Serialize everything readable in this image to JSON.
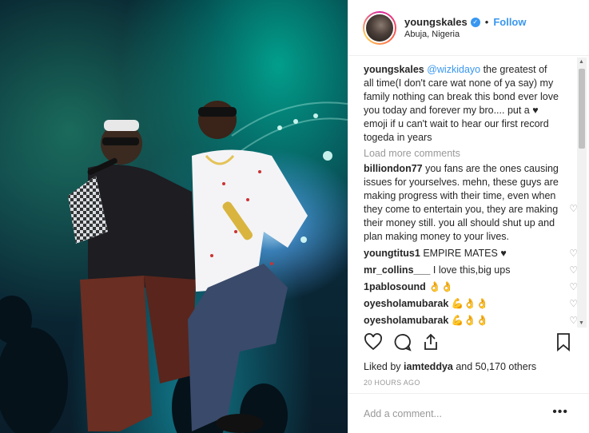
{
  "post": {
    "username": "youngskales",
    "separator": "•",
    "follow_label": "Follow",
    "location": "Abuja, Nigeria",
    "verified_icon": "verified-badge-icon"
  },
  "caption": {
    "username": "youngskales",
    "mention": "@wizkidayo",
    "text": " the greatest of all time(I don't care wat none of ya say) my family nothing can break this bond ever love you today and forever my bro.... put a ♥ emoji if u can't wait to hear our first record togeda in years"
  },
  "load_more": "Load more comments",
  "comments": [
    {
      "user": "billiondon77",
      "text": "you fans are the ones causing issues for yourselves. mehn, these guys are making progress with their time, even when they come to entertain you, they are making their money still. you all should shut up and plan making money to your lives."
    },
    {
      "user": "youngtitus1",
      "text": "EMPIRE MATES ♥"
    },
    {
      "user": "mr_collins___",
      "text": "I love this,big ups"
    },
    {
      "user": "1pablosound",
      "text": "👌👌"
    },
    {
      "user": "oyesholamubarak",
      "text": "💪👌👌"
    },
    {
      "user": "oyesholamubarak",
      "text": "💪👌👌"
    }
  ],
  "likes": {
    "prefix": "Liked by ",
    "user": "iamteddya",
    "suffix": " and 50,170 others"
  },
  "timestamp": "20 HOURS AGO",
  "add_comment_placeholder": "Add a comment...",
  "more_label": "•••",
  "icons": [
    "heart-icon",
    "comment-icon",
    "share-icon",
    "bookmark-icon"
  ],
  "colors": {
    "link": "#3897f0",
    "muted": "#999999",
    "border": "#efefef"
  }
}
